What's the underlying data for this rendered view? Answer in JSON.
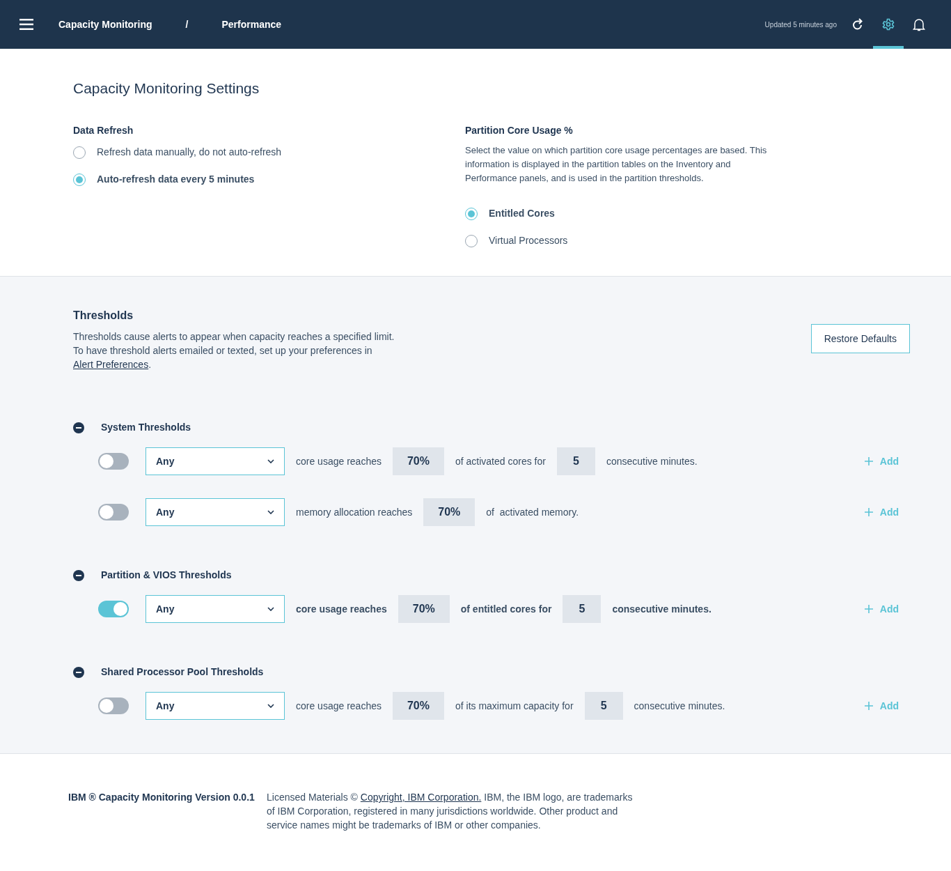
{
  "header": {
    "breadcrumbs": [
      "Capacity Monitoring",
      "/",
      "Performance"
    ],
    "updated": "Updated 5 minutes ago",
    "settings_selected": true
  },
  "title": "Capacity Monitoring Settings",
  "data_refresh": {
    "heading": "Data Refresh",
    "options": [
      {
        "label": "Refresh data manually, do not auto-refresh",
        "selected": false
      },
      {
        "label": "Auto-refresh data every 5 minutes",
        "selected": true
      }
    ]
  },
  "core_usage": {
    "heading": "Partition Core Usage %",
    "description": "Select the value on which partition core usage percentages are based. This information is displayed in the partition tables on the Inventory and Performance panels, and is used in the partition thresholds.",
    "options": [
      {
        "label": "Entitled Cores",
        "selected": true
      },
      {
        "label": "Virtual Processors",
        "selected": false
      }
    ]
  },
  "thresholds": {
    "heading": "Thresholds",
    "description_lines": [
      "Thresholds cause alerts to appear when capacity reaches a specified limit.",
      "To have threshold alerts emailed or texted, set up your preferences in"
    ],
    "link": "Alert Preferences",
    "after_link": ".",
    "restore_button": "Restore Defaults",
    "groups": [
      {
        "title": "System Thresholds",
        "expanded": true,
        "rows": [
          {
            "on": false,
            "select": "Any",
            "parts": [
              {
                "kind": "text",
                "text": "core usage reaches"
              },
              {
                "kind": "value",
                "text": "70%"
              },
              {
                "kind": "text",
                "text": "of activated cores for"
              },
              {
                "kind": "value",
                "text": "5"
              },
              {
                "kind": "text",
                "text": "consecutive minutes."
              }
            ],
            "add": "Add"
          },
          {
            "on": false,
            "select": "Any",
            "parts": [
              {
                "kind": "text",
                "text": "memory allocation reaches"
              },
              {
                "kind": "value",
                "text": "70%"
              },
              {
                "kind": "text",
                "text": "of  activated memory."
              }
            ],
            "add": "Add"
          }
        ]
      },
      {
        "title": "Partition & VIOS Thresholds",
        "expanded": true,
        "rows": [
          {
            "on": true,
            "select": "Any",
            "parts": [
              {
                "kind": "text",
                "text": "core usage reaches"
              },
              {
                "kind": "value",
                "text": "70%"
              },
              {
                "kind": "text",
                "text": "of entitled cores for"
              },
              {
                "kind": "value",
                "text": "5"
              },
              {
                "kind": "text",
                "text": "consecutive minutes."
              }
            ],
            "add": "Add"
          }
        ]
      },
      {
        "title": "Shared Processor Pool Thresholds",
        "expanded": true,
        "rows": [
          {
            "on": false,
            "select": "Any",
            "parts": [
              {
                "kind": "text",
                "text": "core usage reaches"
              },
              {
                "kind": "value",
                "text": "70%"
              },
              {
                "kind": "text",
                "text": "of its maximum capacity for"
              },
              {
                "kind": "value",
                "text": "5"
              },
              {
                "kind": "text",
                "text": "consecutive minutes."
              }
            ],
            "add": "Add"
          }
        ]
      }
    ]
  },
  "footer": {
    "product": "IBM ® Capacity Monitoring Version 0.0.1",
    "before_link": "Licensed Materials © ",
    "link": "Copyright, IBM Corporation.",
    "after_link": " IBM, the IBM logo, are trademarks of IBM Corporation, registered in many jurisdictions worldwide. Other product and service names might be trademarks of IBM or other companies."
  }
}
